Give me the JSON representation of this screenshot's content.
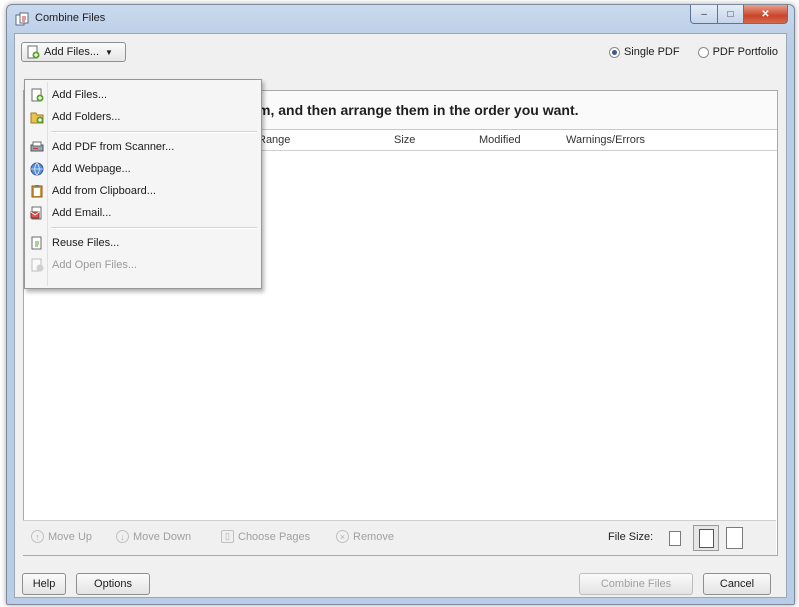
{
  "window": {
    "title": "Combine Files"
  },
  "toolbar": {
    "add_files_label": "Add Files...",
    "output_options": [
      {
        "label": "Single PDF",
        "selected": true
      },
      {
        "label": "PDF Portfolio",
        "selected": false
      }
    ]
  },
  "panel": {
    "instruction_visible": "m, and then arrange them in the order you want.",
    "columns": [
      "Range",
      "Size",
      "Modified",
      "Warnings/Errors"
    ]
  },
  "menu": {
    "items": [
      {
        "label": "Add Files...",
        "icon": "add-files-icon",
        "enabled": true
      },
      {
        "label": "Add Folders...",
        "icon": "add-folders-icon",
        "enabled": true
      },
      {
        "label": "Add PDF from Scanner...",
        "icon": "scanner-icon",
        "enabled": true
      },
      {
        "label": "Add Webpage...",
        "icon": "webpage-icon",
        "enabled": true
      },
      {
        "label": "Add from Clipboard...",
        "icon": "clipboard-icon",
        "enabled": true
      },
      {
        "label": "Add Email...",
        "icon": "email-icon",
        "enabled": true
      },
      {
        "label": "Reuse Files...",
        "icon": "reuse-files-icon",
        "enabled": true
      },
      {
        "label": "Add Open Files...",
        "icon": "open-files-icon",
        "enabled": false
      }
    ]
  },
  "bottom_tools": {
    "move_up": "Move Up",
    "move_down": "Move Down",
    "choose_pages": "Choose Pages",
    "remove": "Remove",
    "file_size_label": "File Size:"
  },
  "footer": {
    "help": "Help",
    "options": "Options",
    "combine": "Combine Files",
    "cancel": "Cancel"
  },
  "colors": {
    "title_bar": "#c9d9ee",
    "close_button": "#c9442a",
    "radio_selected": "#3b5a86"
  }
}
